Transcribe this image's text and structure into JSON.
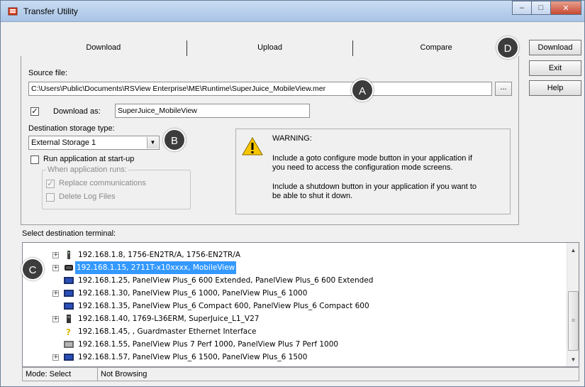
{
  "window": {
    "title": "Transfer Utility",
    "controls": {
      "minimize": "–",
      "maximize": "□",
      "close": "✕"
    }
  },
  "tabs": [
    "Download",
    "Upload",
    "Compare"
  ],
  "source": {
    "label": "Source file:",
    "value": "C:\\Users\\Public\\Documents\\RSView Enterprise\\ME\\Runtime\\SuperJuice_MobileView.mer",
    "browse_label": "..."
  },
  "download_as": {
    "checked": true,
    "label": "Download as:",
    "value": "SuperJuice_MobileView"
  },
  "destination_storage": {
    "label": "Destination storage type:",
    "selected": "External Storage 1"
  },
  "run_at_startup": {
    "checked": false,
    "label": "Run application at start-up"
  },
  "when_runs": {
    "title": "When application runs:",
    "replace_comms": {
      "checked": true,
      "label": "Replace communications"
    },
    "delete_logs": {
      "checked": false,
      "label": "Delete Log Files"
    }
  },
  "warning": {
    "title": "WARNING:",
    "line1a": "Include a goto configure mode button in your application if",
    "line1b": "you need to access the configuration mode screens.",
    "line2a": "Include a shutdown button in your application if you want to",
    "line2b": "be able to shut it down."
  },
  "buttons": {
    "download": "Download",
    "exit": "Exit",
    "help": "Help"
  },
  "callouts": {
    "a": "A",
    "b": "B",
    "c": "C",
    "d": "D"
  },
  "terminal_list": {
    "label": "Select destination terminal:",
    "items": [
      {
        "text": "192.168.1.8, 1756-EN2TR/A, 1756-EN2TR/A",
        "icon": "module-icon",
        "expander": "+"
      },
      {
        "text": "192.168.1.15, 2711T-x10xxxx, MobileView",
        "icon": "mobileview-icon",
        "expander": "+",
        "selected": true
      },
      {
        "text": "192.168.1.25, PanelView Plus_6 600 Extended, PanelView Plus_6 600 Extended",
        "icon": "panelview-icon"
      },
      {
        "text": "192.168.1.30, PanelView Plus_6 1000, PanelView Plus_6 1000",
        "icon": "panelview-icon",
        "expander": "+"
      },
      {
        "text": "192.168.1.35, PanelView Plus_6 Compact 600, PanelView Plus_6 Compact 600",
        "icon": "panelview-icon"
      },
      {
        "text": "192.168.1.40, 1769-L36ERM, SuperJuice_L1_V27",
        "icon": "controller-icon",
        "expander": "+"
      },
      {
        "text": "192.168.1.45, , Guardmaster Ethernet Interface",
        "icon": "unknown-device-icon"
      },
      {
        "text": "192.168.1.55, PanelView Plus 7 Perf 1000, PanelView Plus 7 Perf 1000",
        "icon": "panelview-grey-icon"
      },
      {
        "text": "192.168.1.57, PanelView Plus_6 1500, PanelView Plus_6 1500",
        "icon": "panelview-icon",
        "expander": "+"
      }
    ]
  },
  "status": {
    "mode": "Mode: Select",
    "browsing": "Not Browsing"
  }
}
